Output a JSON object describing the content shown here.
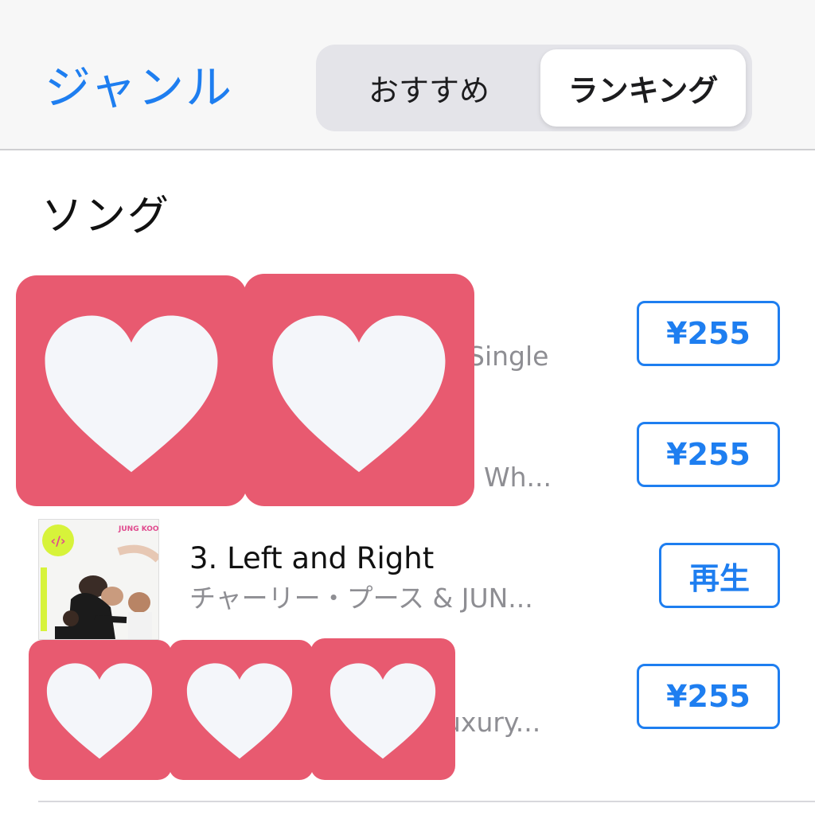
{
  "header": {
    "genre_label": "ジャンル",
    "tabs": [
      {
        "label": "おすすめ",
        "selected": false
      },
      {
        "label": "ランキング",
        "selected": true
      }
    ]
  },
  "section": {
    "title": "ソング"
  },
  "songs": [
    {
      "title": "",
      "artist": "Single",
      "action": "¥255"
    },
    {
      "title": "",
      "artist": "Wh...",
      "action": "¥255"
    },
    {
      "title": "3. Left and Right",
      "artist": "チャーリー・プース & JUN...",
      "action": "再生"
    },
    {
      "title": "",
      "artist": "uxury...",
      "action": "¥255"
    }
  ],
  "album_art": {
    "row3": {
      "label": "JUNG KOOK"
    }
  },
  "colors": {
    "accent": "#1e7ef0",
    "sticker": "#e85a70",
    "heart": "#f4f6fa"
  }
}
